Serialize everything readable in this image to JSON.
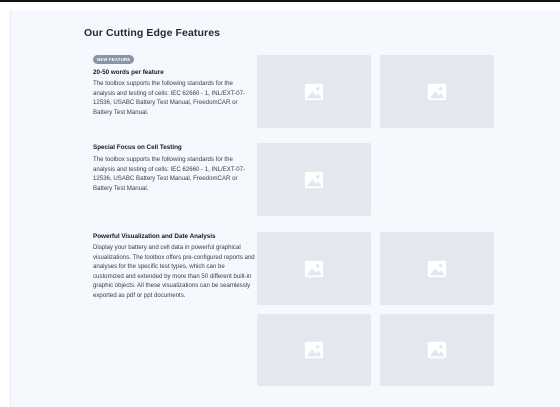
{
  "page": {
    "title": "Our Cutting Edge Features"
  },
  "features": [
    {
      "badge": "NEW FEATURE",
      "heading": "20-50 words per feature",
      "body": "The toolbox supports the following standards for the analysis and testing of cells: IEC 62660 - 1, INL/EXT-07-12536, USABC Battery Test Manual, FreedomCAR or Battery Test Manual."
    },
    {
      "heading": "Special Focus on Cell Testing",
      "body": "The toolbox supports the following standards for the analysis and testing of cells: IEC 62660 - 1, INL/EXT-07-12536, USABC Battery Test Manual, FreedomCAR or Battery Test Manual."
    },
    {
      "heading": "Powerful Visualization and Date Analysis",
      "body": "Display your battery and cell data in powerful graphical visualizations. The toolbox offers pre-configured reports and analyses for the specific test types, which can be customized and extended by more than 50 different built-in graphic objects. All these visualizations can be seamlessly exported as pdf or ppt documents."
    }
  ],
  "icons": {
    "placeholder": "image-placeholder-icon"
  },
  "colors": {
    "panel_background": "#f5f8fc",
    "placeholder_fill": "#e3e8ef",
    "badge_fill": "#8895a6",
    "title_text": "#1f2937"
  }
}
